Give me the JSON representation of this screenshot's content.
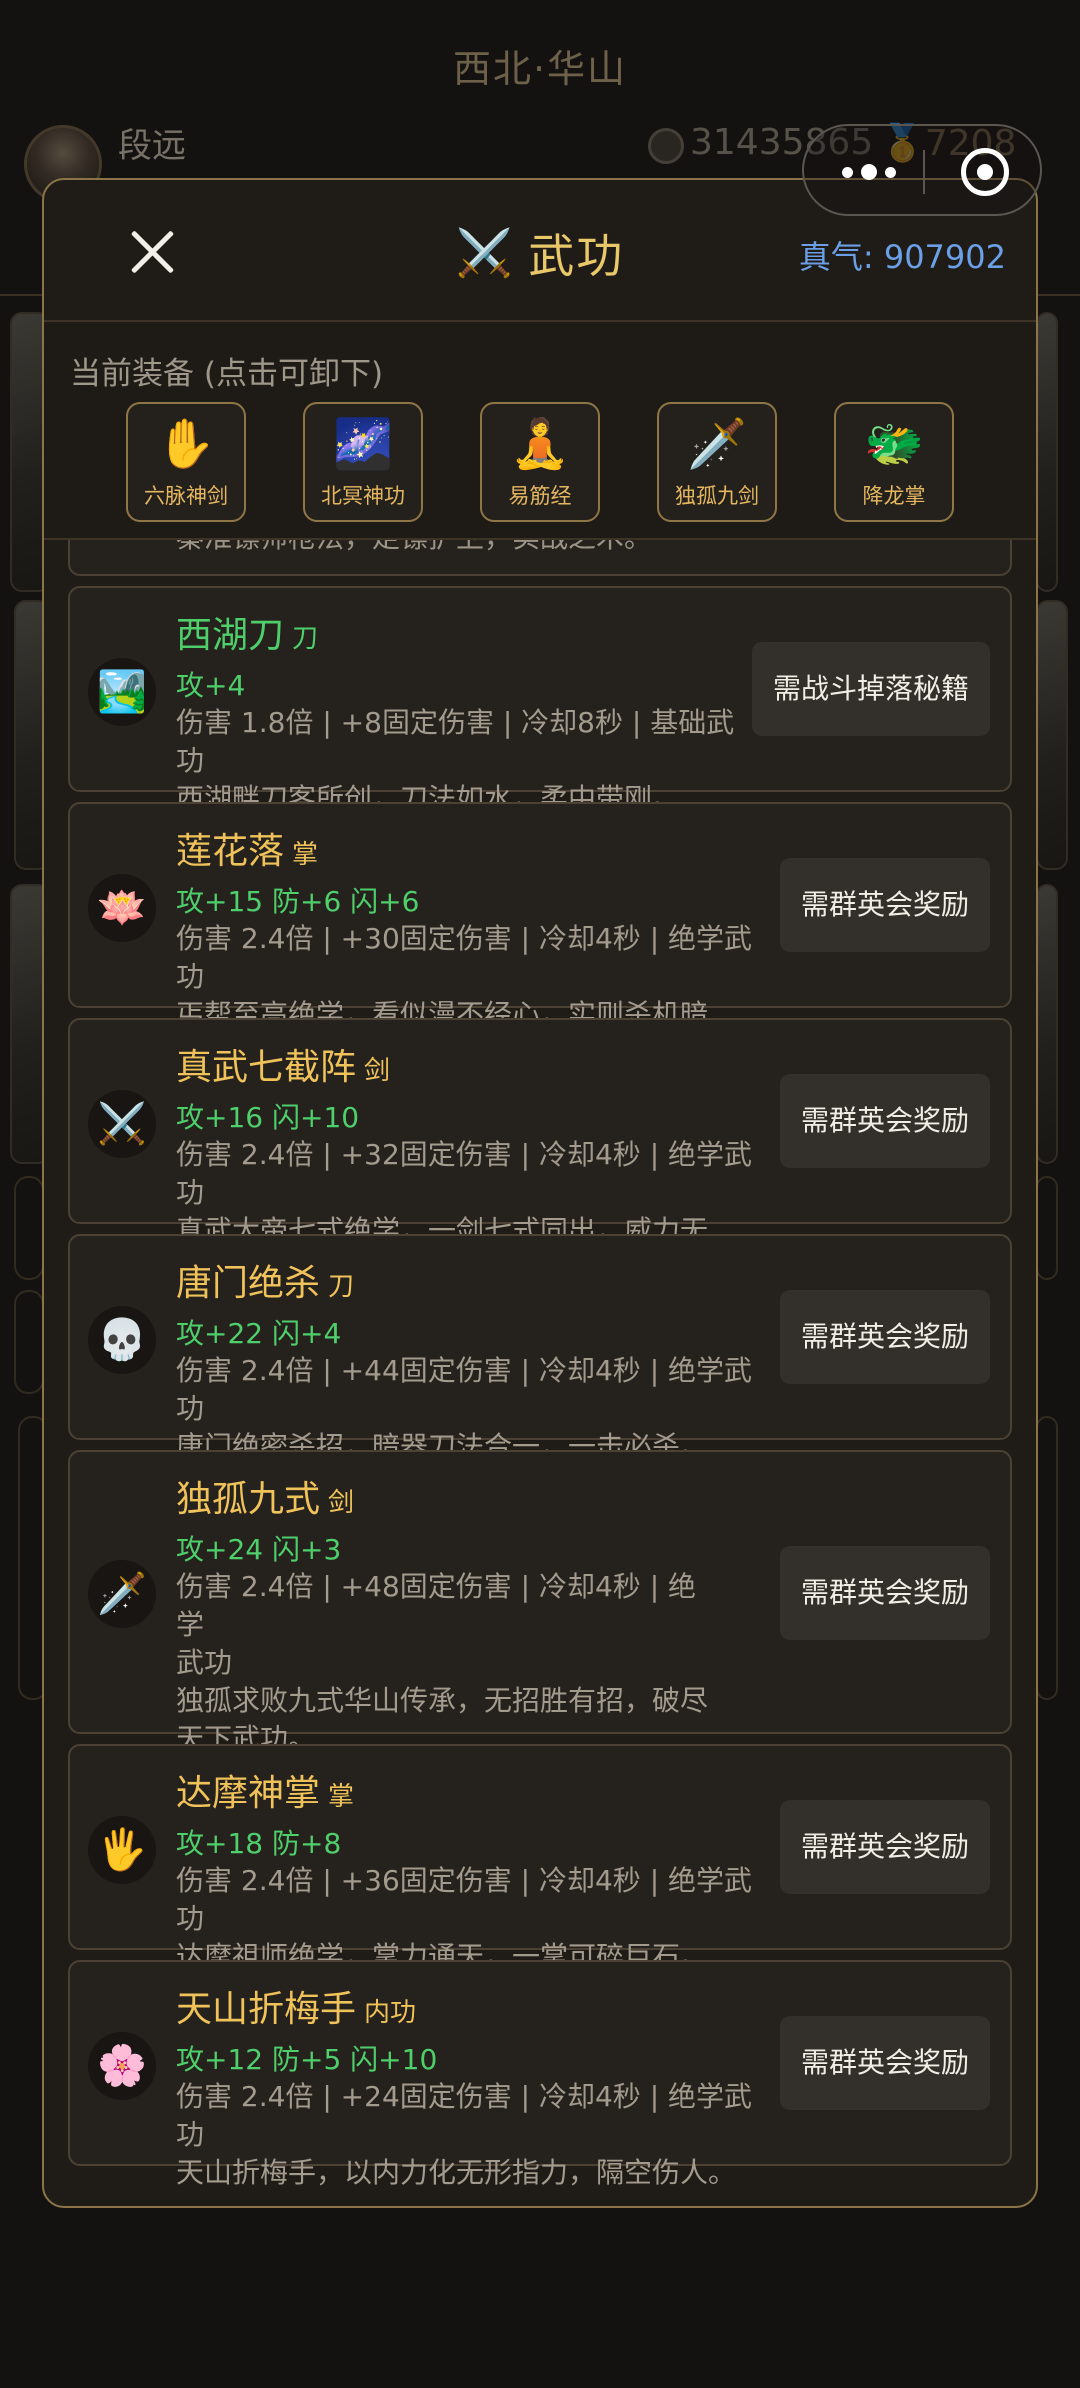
{
  "background": {
    "location_title": "西北·华山",
    "username": "段远",
    "coins": "31435865",
    "ingots": "7208"
  },
  "modal": {
    "title_icon": "⚔️",
    "title": "武功",
    "qi_label": "真气: 907902",
    "equip_heading": "当前装备 (点击可卸下)",
    "equipped": [
      {
        "icon": "✋",
        "label": "六脉神剑"
      },
      {
        "icon": "🌌",
        "label": "北冥神功"
      },
      {
        "icon": "🧘",
        "label": "易筋经"
      },
      {
        "icon": "🗡️",
        "label": "独孤九剑"
      },
      {
        "icon": "🐲",
        "label": "降龙掌"
      }
    ],
    "partial_text": "秦淮镖师枪法，走镖护卫，实战之术。",
    "skills": [
      {
        "icon": "🏞️",
        "name": "西湖刀",
        "type": "刀",
        "stats": "攻+4",
        "desc1": "伤害 1.8倍 | +8固定伤害 | 冷却8秒 | 基础武功",
        "desc2": "西湖畔刀客所创，刀法如水，柔中带刚。",
        "button": "需战斗掉落秘籍"
      },
      {
        "icon": "🪷",
        "name": "莲花落",
        "type": "掌",
        "stats": "攻+15 防+6 闪+6",
        "desc1": "伤害 2.4倍 | +30固定伤害 | 冷却4秒 | 绝学武功",
        "desc2": "丐帮至高绝学，看似漫不经心，实则杀机暗藏。",
        "button": "需群英会奖励"
      },
      {
        "icon": "⚔️",
        "name": "真武七截阵",
        "type": "剑",
        "stats": "攻+16 闪+10",
        "desc1": "伤害 2.4倍 | +32固定伤害 | 冷却4秒 | 绝学武功",
        "desc2": "真武大帝七式绝学，一剑七式同出，威力无穷。",
        "button": "需群英会奖励"
      },
      {
        "icon": "💀",
        "name": "唐门绝杀",
        "type": "刀",
        "stats": "攻+22 闪+4",
        "desc1": "伤害 2.4倍 | +44固定伤害 | 冷却4秒 | 绝学武功",
        "desc2": "唐门绝密杀招，暗器刀法合一，一击必杀。",
        "button": "需群英会奖励"
      },
      {
        "icon": "🗡️",
        "name": "独孤九式",
        "type": "剑",
        "stats": "攻+24 闪+3",
        "desc1a": "伤害 2.4倍 | +48固定伤害 | 冷却4秒 | 绝学",
        "desc1b": "武功",
        "desc2a": "独孤求败九式华山传承，无招胜有招，破尽",
        "desc2b": "天下武功。",
        "button": "需群英会奖励"
      },
      {
        "icon": "🖐️",
        "name": "达摩神掌",
        "type": "掌",
        "stats": "攻+18 防+8",
        "desc1": "伤害 2.4倍 | +36固定伤害 | 冷却4秒 | 绝学武功",
        "desc2": "达摩祖师绝学，掌力通天，一掌可碎巨石。",
        "button": "需群英会奖励"
      },
      {
        "icon": "🌸",
        "name": "天山折梅手",
        "type": "内功",
        "stats": "攻+12 防+5 闪+10",
        "desc1": "伤害 2.4倍 | +24固定伤害 | 冷却4秒 | 绝学武功",
        "desc2": "天山折梅手，以内力化无形指力，隔空伤人。",
        "button": "需群英会奖励"
      }
    ]
  }
}
